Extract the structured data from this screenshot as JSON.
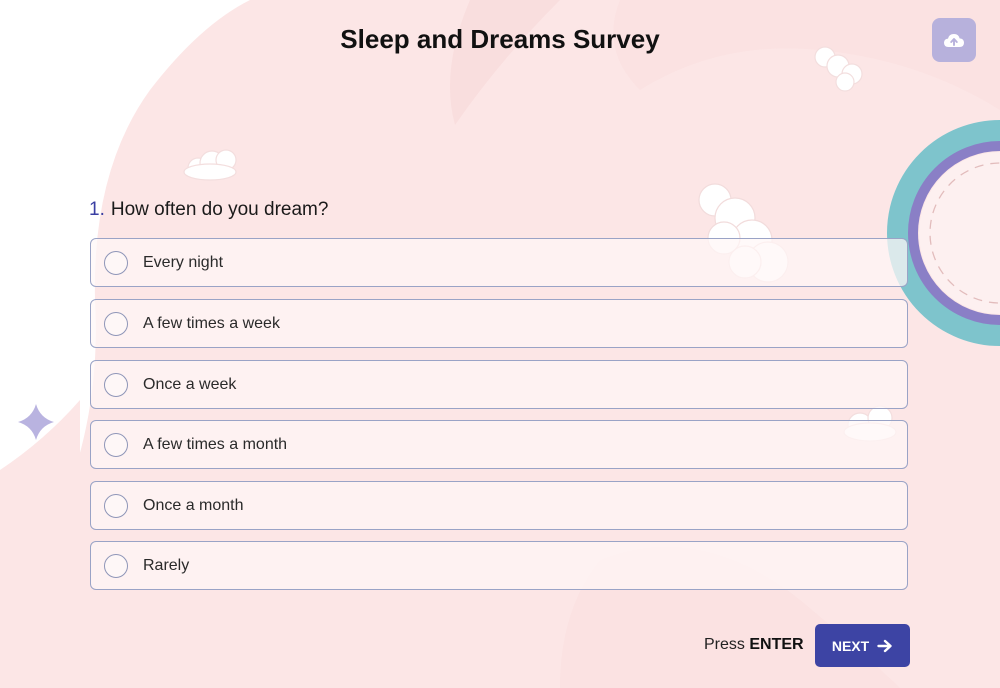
{
  "survey": {
    "title": "Sleep and Dreams Survey"
  },
  "toolbar": {
    "upload_icon": "cloud-upload-icon"
  },
  "question": {
    "number": "1.",
    "text": "How often do you dream?",
    "options": [
      {
        "label": "Every night"
      },
      {
        "label": "A few times a week"
      },
      {
        "label": "Once a week"
      },
      {
        "label": "A few times a month"
      },
      {
        "label": "Once a month"
      },
      {
        "label": "Rarely"
      }
    ]
  },
  "footer": {
    "press_prefix": "Press",
    "press_key": "ENTER",
    "next_label": "NEXT",
    "next_icon": "arrow-right-icon"
  },
  "colors": {
    "accent": "#3d44a4",
    "background_blob": "#fce6e6",
    "ring_teal": "#7ec4cc",
    "ring_purple": "#8a7fc6",
    "sparkle": "#b9b3e0"
  }
}
